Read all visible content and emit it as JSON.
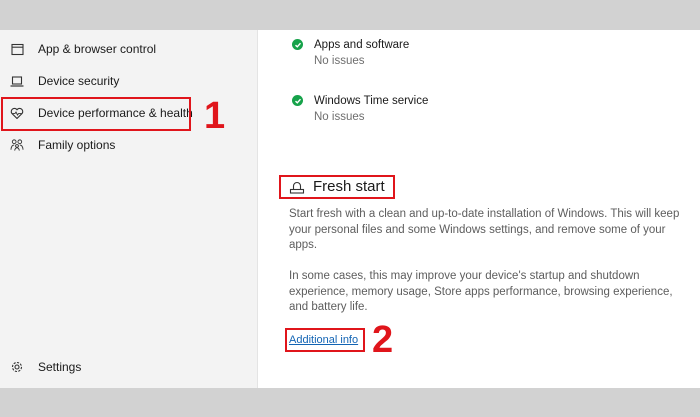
{
  "sidebar": {
    "items": [
      {
        "label": "App & browser control",
        "icon": "app-browser-icon"
      },
      {
        "label": "Device security",
        "icon": "laptop-icon"
      },
      {
        "label": "Device performance & health",
        "icon": "heart-pulse-icon"
      },
      {
        "label": "Family options",
        "icon": "family-icon"
      }
    ],
    "settings": {
      "label": "Settings",
      "icon": "gear-icon"
    }
  },
  "main": {
    "status_items": [
      {
        "title": "Apps and software",
        "subtitle": "No issues",
        "icon": "check-icon"
      },
      {
        "title": "Windows Time service",
        "subtitle": "No issues",
        "icon": "check-icon"
      }
    ],
    "fresh_start": {
      "title": "Fresh start",
      "icon": "fresh-start-icon",
      "paragraph1": "Start fresh with a clean and up-to-date installation of Windows. This will keep your personal files and some Windows settings, and remove some of your apps.",
      "paragraph2": "In some cases, this may improve your device's startup and shutdown experience, memory usage, Store apps performance, browsing experience, and battery life.",
      "link": "Additional info"
    }
  },
  "annotations": {
    "callout_1": "1",
    "callout_2": "2",
    "callout_color": "#e0151b"
  },
  "colors": {
    "check_green": "#16a24a",
    "link_blue": "#1264b4"
  }
}
